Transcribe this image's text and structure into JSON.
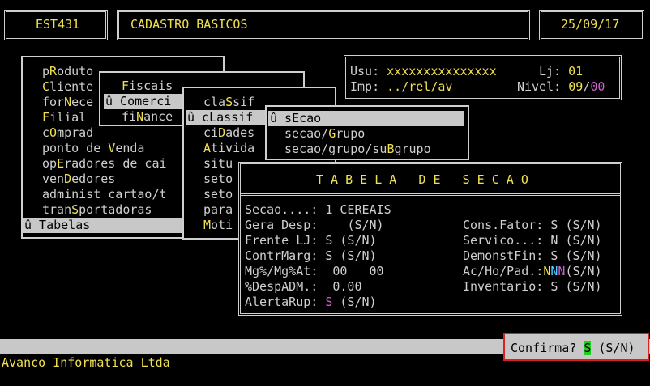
{
  "header": {
    "program": "EST431",
    "title": "CADASTRO BASICOS",
    "date": "25/09/17"
  },
  "info": {
    "usu_label": "Usu:",
    "usu_value": "xxxxxxxxxxxxxxx",
    "lj_label": "Lj:",
    "lj_value": "01",
    "imp_label": "Imp:",
    "imp_value": "../rel/av",
    "nivel_label": "Nivel:",
    "nivel_a": "09",
    "nivel_sep": "/",
    "nivel_b": "00"
  },
  "menu1": [
    {
      "pre": "p",
      "hot": "R",
      "post": "oduto"
    },
    {
      "pre": "",
      "hot": "C",
      "post": "liente"
    },
    {
      "pre": "for",
      "hot": "N",
      "post": "ece"
    },
    {
      "pre": "",
      "hot": "F",
      "post": "ilial"
    },
    {
      "pre": "c",
      "hot": "O",
      "post": "mprad"
    },
    {
      "pre": "ponto de ",
      "hot": "V",
      "post": "enda"
    },
    {
      "pre": "op",
      "hot": "E",
      "post": "radores de cai"
    },
    {
      "pre": "ven",
      "hot": "D",
      "post": "edores"
    },
    {
      "pre": "administ cartao/t",
      "hot": "",
      "post": ""
    },
    {
      "pre": "tran",
      "hot": "S",
      "post": "portadoras"
    },
    {
      "pre": "û Tabelas",
      "hot": "",
      "post": ""
    }
  ],
  "menu2": [
    {
      "pre": "",
      "hot": "F",
      "post": "iscais"
    },
    {
      "pre": "û Comerci",
      "hot": "",
      "post": ""
    },
    {
      "pre": "fi",
      "hot": "N",
      "post": "ance"
    }
  ],
  "menu3": [
    {
      "pre": "cla",
      "hot": "S",
      "post": "sif"
    },
    {
      "pre": "û cLassif",
      "hot": "",
      "post": ""
    },
    {
      "pre": "ci",
      "hot": "D",
      "post": "ades"
    },
    {
      "pre": "",
      "hot": "A",
      "post": "tivida"
    },
    {
      "pre": "situ",
      "hot": "",
      "post": ""
    },
    {
      "pre": "seto",
      "hot": "",
      "post": ""
    },
    {
      "pre": "seto",
      "hot": "",
      "post": ""
    },
    {
      "pre": "para",
      "hot": "",
      "post": ""
    },
    {
      "pre": "",
      "hot": "M",
      "post": "oti"
    }
  ],
  "menu4": [
    {
      "pre": "û sEcao",
      "hot": "",
      "post": ""
    },
    {
      "pre": "secao/",
      "hot": "G",
      "post": "rupo"
    },
    {
      "pre": "secao/grupo/su",
      "hot": "B",
      "post": "grupo"
    }
  ],
  "dialog": {
    "title": "T A B E L A   D E   S E C A O",
    "secao_label": "Secao....:",
    "secao_value": "1 CEREAIS",
    "gera_label": "Gera Desp:",
    "gera_value": " ",
    "gera_opts": "(S/N)",
    "frente_label": "Frente LJ:",
    "frente_value": "S",
    "frente_opts": "(S/N)",
    "contr_label": "ContrMarg:",
    "contr_value": "S",
    "contr_opts": "(S/N)",
    "mg_label": "Mg%/Mg%At:",
    "mg_value1": "00",
    "mg_value2": "00",
    "desp_label": "%DespADM.:",
    "desp_value": "0.00",
    "alerta_label": "AlertaRup:",
    "alerta_value": "S",
    "alerta_opts": "(S/N)",
    "cons_label": "Cons.Fator:",
    "cons_value": "S",
    "cons_opts": "(S/N)",
    "serv_label": "Servico...:",
    "serv_value": "N",
    "serv_opts": "(S/N)",
    "demonst_label": "DemonstFin:",
    "demonst_value": "S",
    "demonst_opts": "(S/N)",
    "acho_label": "Ac/Ho/Pad.:",
    "acho_n1": "N",
    "acho_n2": "N",
    "acho_n3": "N",
    "acho_opts": "(S/N)",
    "invent_label": "Inventario:",
    "invent_value": "S",
    "invent_opts": "(S/N)"
  },
  "confirm": {
    "label": "Confirma?",
    "value": "S",
    "opts": "(S/N)"
  },
  "footer": "Avanco Informatica Ltda",
  "colors": {
    "background": "#000000",
    "text": "#cfcfcf",
    "highlight_yellow": "#f0e050",
    "highlight_magenta": "#d060d0",
    "highlight_green": "#50ff50",
    "highlight_cyan": "#50d0ff",
    "selection": "#c8c8c8",
    "confirm_border": "#e02020"
  }
}
